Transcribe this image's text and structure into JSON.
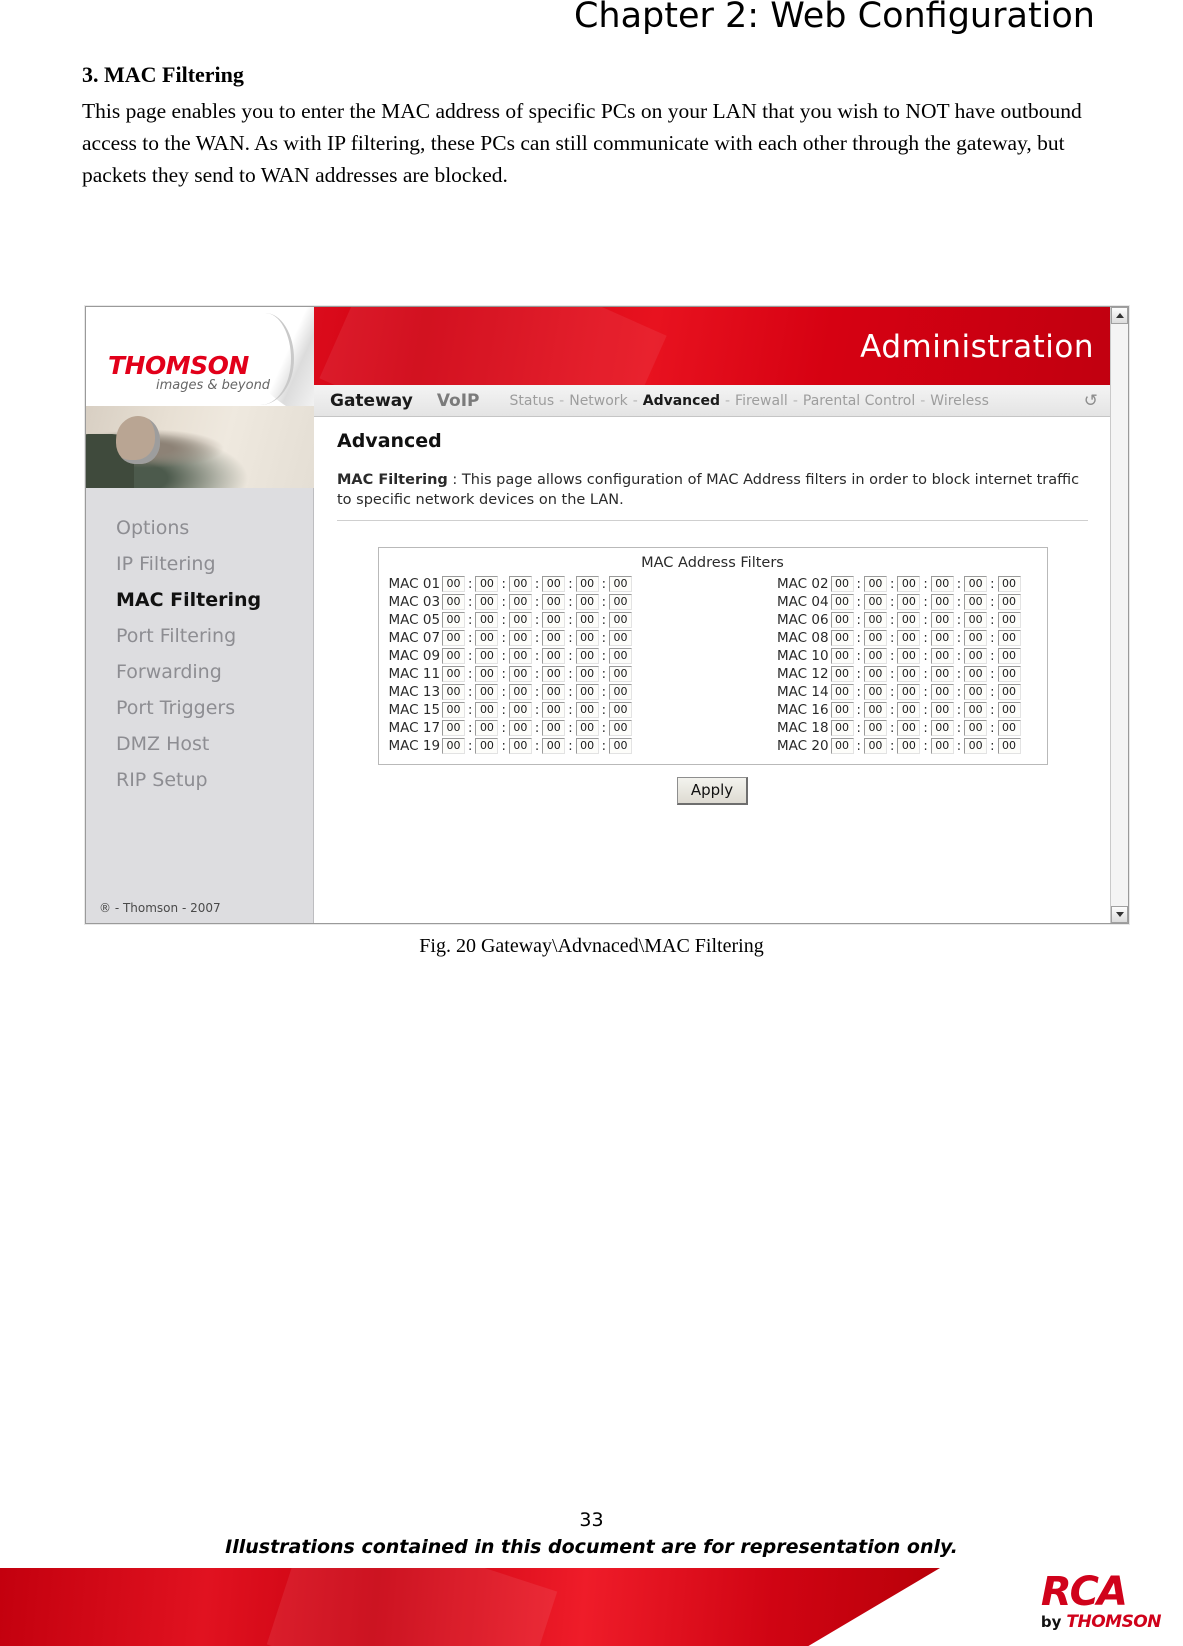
{
  "document": {
    "chapter_title": "Chapter 2: Web Configuration",
    "section_heading": "3. MAC Filtering",
    "section_body": "This page enables you to enter the MAC address of specific PCs on your LAN that you wish to NOT have outbound access to the WAN. As with IP filtering, these PCs can still communicate with each other through the gateway, but packets they send to WAN addresses are blocked.",
    "figure_caption": "Fig. 20 Gateway\\Advnaced\\MAC Filtering",
    "page_number": "33",
    "footer_note": "Illustrations contained in this document are for representation only.",
    "logo": {
      "word": "RCA",
      "by": "by",
      "brand": "THOMSON"
    }
  },
  "screenshot": {
    "brand": {
      "logo_text": "THOMSON",
      "logo_tagline": "images & beyond"
    },
    "banner": {
      "title": "Administration"
    },
    "nav": {
      "primary": [
        {
          "label": "Gateway",
          "active": true
        },
        {
          "label": "VoIP",
          "active": false
        }
      ],
      "secondary": [
        {
          "label": "Status",
          "active": false
        },
        {
          "label": "Network",
          "active": false
        },
        {
          "label": "Advanced",
          "active": true
        },
        {
          "label": "Firewall",
          "active": false
        },
        {
          "label": "Parental Control",
          "active": false
        },
        {
          "label": "Wireless",
          "active": false
        }
      ],
      "separator": "-",
      "refresh_icon": "refresh-icon",
      "refresh_glyph": "↺"
    },
    "sidebar": {
      "items": [
        {
          "label": "Options",
          "active": false
        },
        {
          "label": "IP Filtering",
          "active": false
        },
        {
          "label": "MAC Filtering",
          "active": true
        },
        {
          "label": "Port Filtering",
          "active": false
        },
        {
          "label": "Forwarding",
          "active": false
        },
        {
          "label": "Port Triggers",
          "active": false
        },
        {
          "label": "DMZ Host",
          "active": false
        },
        {
          "label": "RIP Setup",
          "active": false
        }
      ],
      "copyright": "® - Thomson - 2007"
    },
    "content": {
      "page_title": "Advanced",
      "desc_label": "MAC Filtering",
      "desc_separator": ":",
      "desc_text": "This page allows configuration of MAC Address filters in order to block internet traffic to specific network devices on the LAN."
    },
    "mac_filters": {
      "panel_title": "MAC Address Filters",
      "octet_value": "00",
      "octet_separator": ":",
      "rows": [
        {
          "label": "MAC 01",
          "octets": [
            "00",
            "00",
            "00",
            "00",
            "00",
            "00"
          ]
        },
        {
          "label": "MAC 02",
          "octets": [
            "00",
            "00",
            "00",
            "00",
            "00",
            "00"
          ]
        },
        {
          "label": "MAC 03",
          "octets": [
            "00",
            "00",
            "00",
            "00",
            "00",
            "00"
          ]
        },
        {
          "label": "MAC 04",
          "octets": [
            "00",
            "00",
            "00",
            "00",
            "00",
            "00"
          ]
        },
        {
          "label": "MAC 05",
          "octets": [
            "00",
            "00",
            "00",
            "00",
            "00",
            "00"
          ]
        },
        {
          "label": "MAC 06",
          "octets": [
            "00",
            "00",
            "00",
            "00",
            "00",
            "00"
          ]
        },
        {
          "label": "MAC 07",
          "octets": [
            "00",
            "00",
            "00",
            "00",
            "00",
            "00"
          ]
        },
        {
          "label": "MAC 08",
          "octets": [
            "00",
            "00",
            "00",
            "00",
            "00",
            "00"
          ]
        },
        {
          "label": "MAC 09",
          "octets": [
            "00",
            "00",
            "00",
            "00",
            "00",
            "00"
          ]
        },
        {
          "label": "MAC 10",
          "octets": [
            "00",
            "00",
            "00",
            "00",
            "00",
            "00"
          ]
        },
        {
          "label": "MAC 11",
          "octets": [
            "00",
            "00",
            "00",
            "00",
            "00",
            "00"
          ]
        },
        {
          "label": "MAC 12",
          "octets": [
            "00",
            "00",
            "00",
            "00",
            "00",
            "00"
          ]
        },
        {
          "label": "MAC 13",
          "octets": [
            "00",
            "00",
            "00",
            "00",
            "00",
            "00"
          ]
        },
        {
          "label": "MAC 14",
          "octets": [
            "00",
            "00",
            "00",
            "00",
            "00",
            "00"
          ]
        },
        {
          "label": "MAC 15",
          "octets": [
            "00",
            "00",
            "00",
            "00",
            "00",
            "00"
          ]
        },
        {
          "label": "MAC 16",
          "octets": [
            "00",
            "00",
            "00",
            "00",
            "00",
            "00"
          ]
        },
        {
          "label": "MAC 17",
          "octets": [
            "00",
            "00",
            "00",
            "00",
            "00",
            "00"
          ]
        },
        {
          "label": "MAC 18",
          "octets": [
            "00",
            "00",
            "00",
            "00",
            "00",
            "00"
          ]
        },
        {
          "label": "MAC 19",
          "octets": [
            "00",
            "00",
            "00",
            "00",
            "00",
            "00"
          ]
        },
        {
          "label": "MAC 20",
          "octets": [
            "00",
            "00",
            "00",
            "00",
            "00",
            "00"
          ]
        }
      ],
      "apply_label": "Apply"
    },
    "scrollbar": {
      "up_icon": "scroll-up-icon",
      "down_icon": "scroll-down-icon"
    },
    "colors": {
      "brand_red": "#e2001a",
      "banner_red": "#d5000f",
      "sidebar_bg": "#dddde0",
      "accent_text": "#8d8d92"
    }
  }
}
